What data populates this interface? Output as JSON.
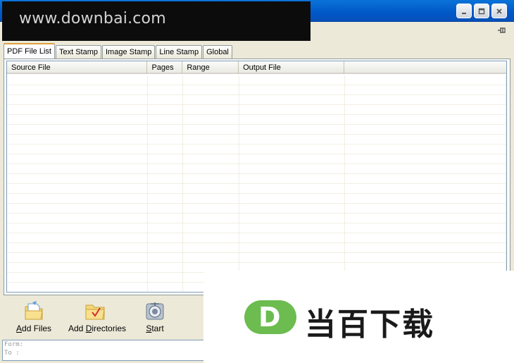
{
  "watermark": {
    "text": "www.downbai.com"
  },
  "window": {
    "buttons": {
      "minimize": "minimize",
      "maximize": "maximize",
      "close": "close"
    }
  },
  "tabs": [
    {
      "label": "PDF File List",
      "active": true
    },
    {
      "label": "Text Stamp",
      "active": false
    },
    {
      "label": "Image Stamp",
      "active": false
    },
    {
      "label": "Line Stamp",
      "active": false
    },
    {
      "label": "Global",
      "active": false
    }
  ],
  "file_list": {
    "columns": [
      "Source File",
      "Pages",
      "Range",
      "Output File",
      ""
    ],
    "rows": []
  },
  "toolbar": {
    "add_files": "Add Files",
    "add_directories": "Add Directories",
    "start": "Start"
  },
  "status": {
    "form_label": "Form:",
    "to_label": "To  :"
  },
  "brand": {
    "mark_letter": "D",
    "name": "当百下载",
    "accent_color": "#6cbc50"
  }
}
